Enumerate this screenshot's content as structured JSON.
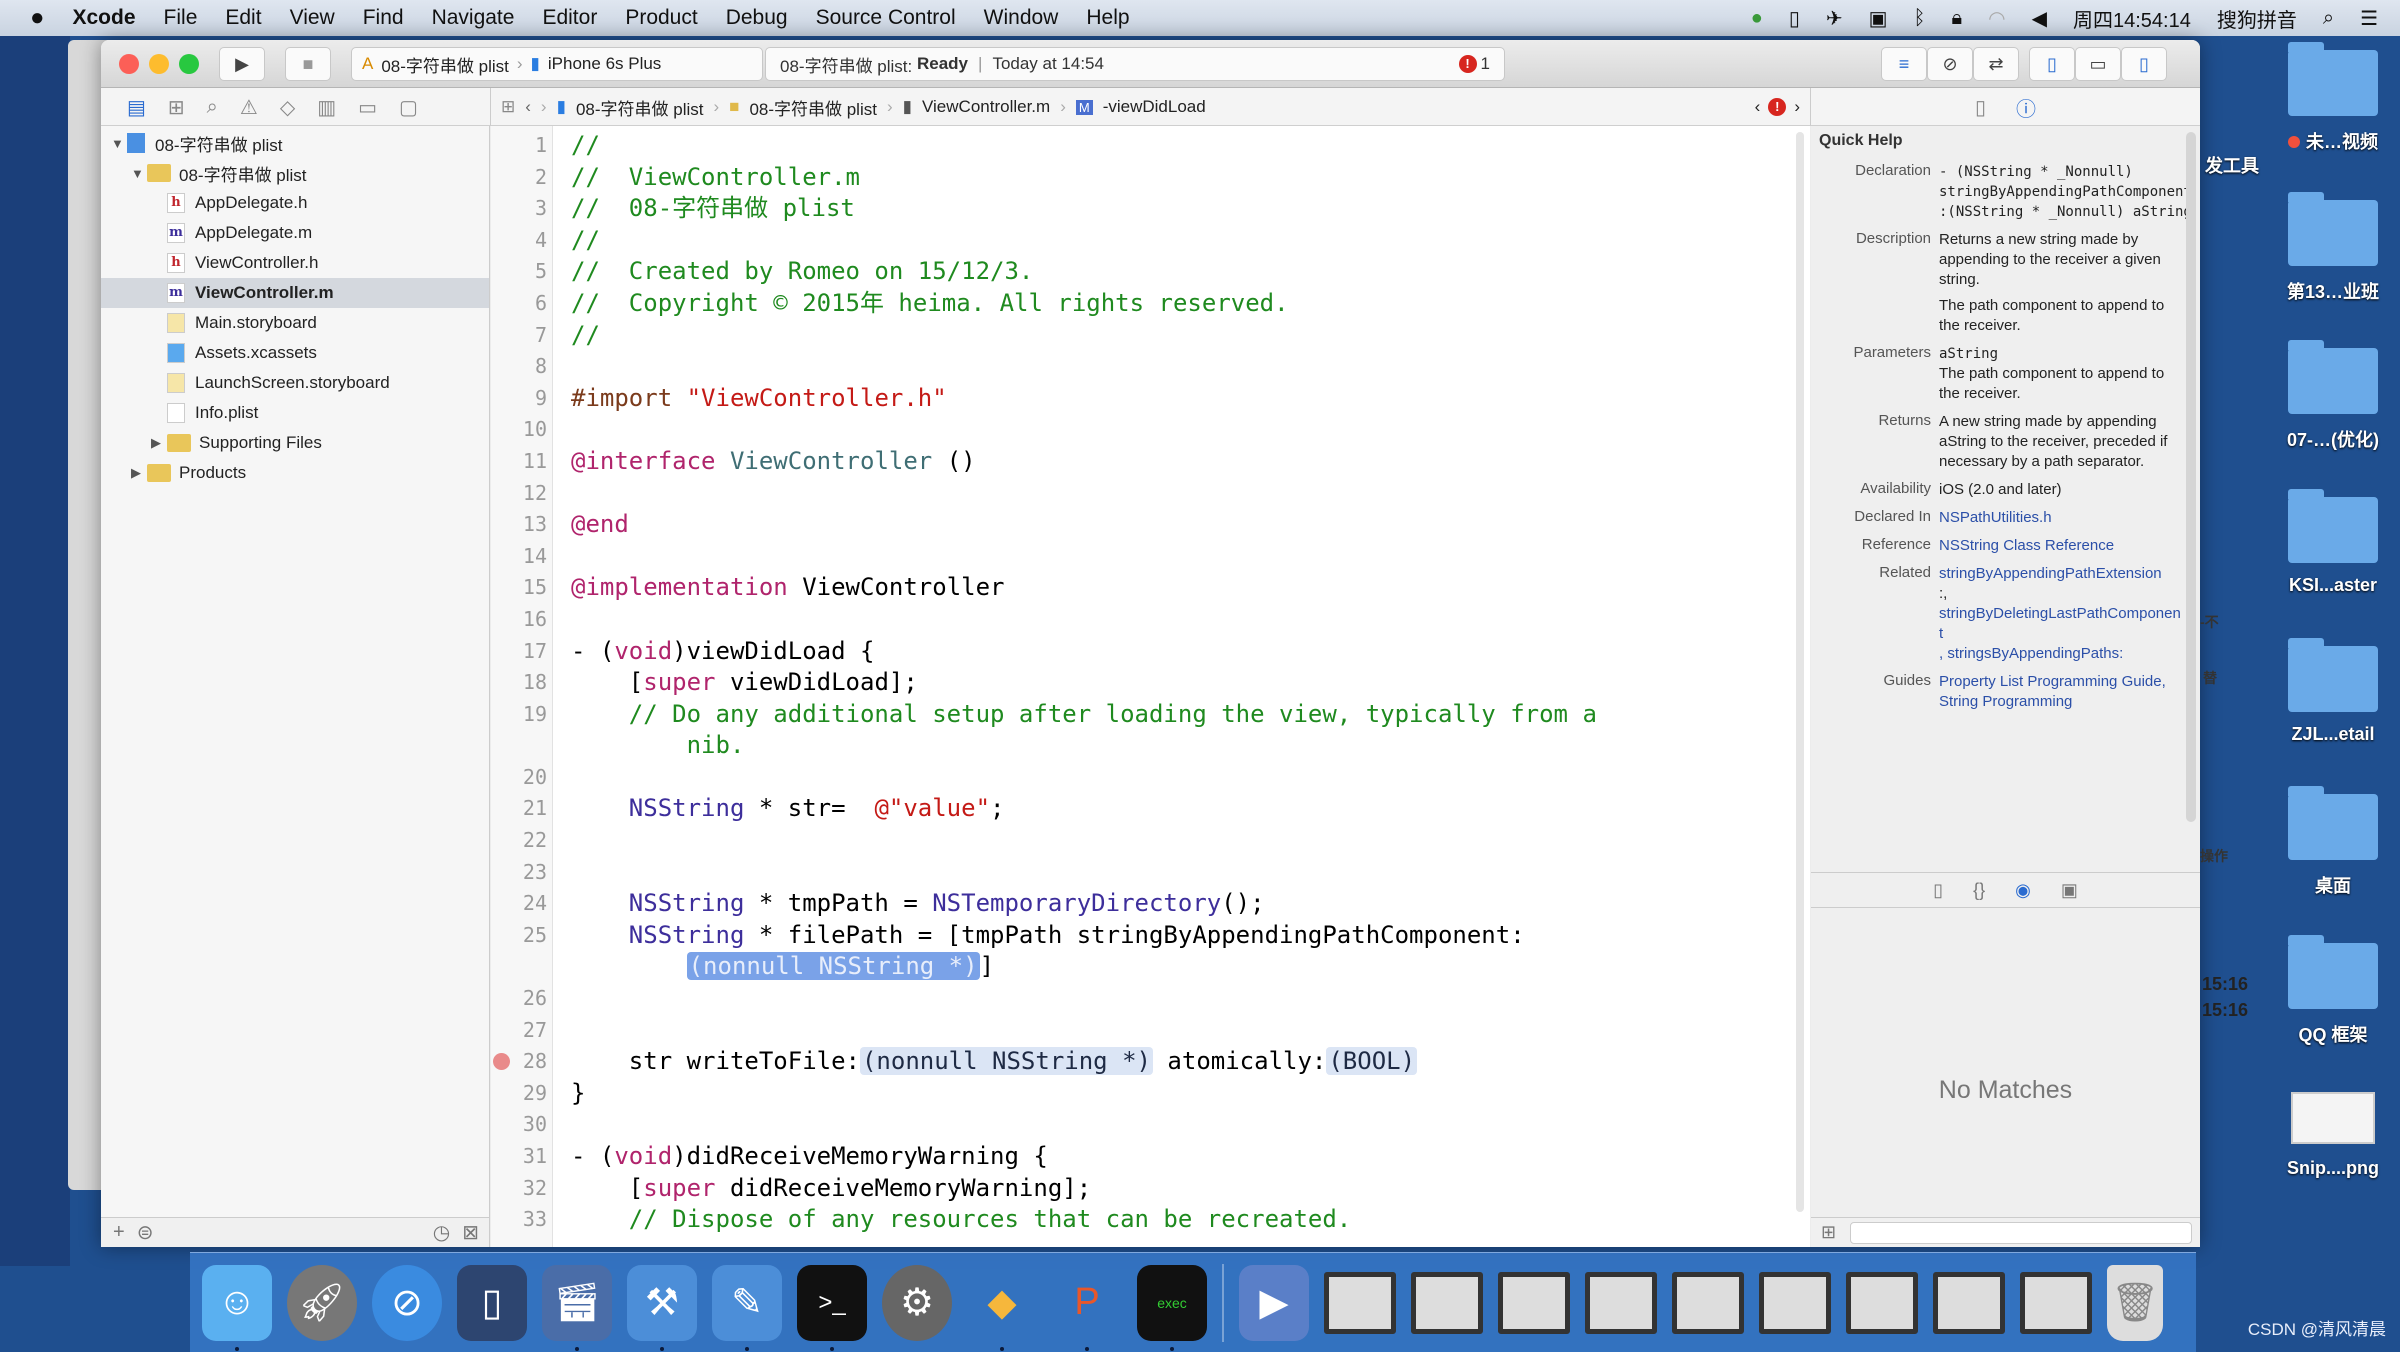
{
  "menubar": {
    "apple": "",
    "items": [
      "Xcode",
      "File",
      "Edit",
      "View",
      "Find",
      "Navigate",
      "Editor",
      "Product",
      "Debug",
      "Source Control",
      "Window",
      "Help"
    ],
    "clock": "周四14:54:14",
    "input_method": "搜狗拼音"
  },
  "toolbar": {
    "scheme": "08-字符串做 plist",
    "device": "iPhone 6s Plus",
    "status_project": "08-字符串做 plist:",
    "status_state": "Ready",
    "status_time": "Today at 14:54",
    "error_count": "1"
  },
  "jumpbar": {
    "crumbs": [
      "08-字符串做 plist",
      "08-字符串做 plist",
      "ViewController.m",
      "-viewDidLoad"
    ],
    "error_count": "!"
  },
  "navigator": {
    "items": [
      {
        "label": "08-字符串做 plist",
        "type": "project",
        "indent": 0,
        "expanded": true
      },
      {
        "label": "08-字符串做 plist",
        "type": "folder",
        "indent": 1,
        "expanded": true
      },
      {
        "label": "AppDelegate.h",
        "type": "h",
        "indent": 2
      },
      {
        "label": "AppDelegate.m",
        "type": "m",
        "indent": 2
      },
      {
        "label": "ViewController.h",
        "type": "h",
        "indent": 2
      },
      {
        "label": "ViewController.m",
        "type": "m",
        "indent": 2,
        "selected": true
      },
      {
        "label": "Main.storyboard",
        "type": "storyboard",
        "indent": 2
      },
      {
        "label": "Assets.xcassets",
        "type": "assets",
        "indent": 2
      },
      {
        "label": "LaunchScreen.storyboard",
        "type": "storyboard",
        "indent": 2
      },
      {
        "label": "Info.plist",
        "type": "plist",
        "indent": 2
      },
      {
        "label": "Supporting Files",
        "type": "folder",
        "indent": 2,
        "expanded": false
      },
      {
        "label": "Products",
        "type": "folder",
        "indent": 1,
        "expanded": false
      }
    ]
  },
  "editor": {
    "lines": [
      {
        "n": "1",
        "s": [
          [
            "//",
            "comment"
          ]
        ]
      },
      {
        "n": "2",
        "s": [
          [
            "//  ViewController.m",
            "comment"
          ]
        ]
      },
      {
        "n": "3",
        "s": [
          [
            "//  08-字符串做 plist",
            "comment"
          ]
        ]
      },
      {
        "n": "4",
        "s": [
          [
            "//",
            "comment"
          ]
        ]
      },
      {
        "n": "5",
        "s": [
          [
            "//  Created by Romeo on 15/12/3.",
            "comment"
          ]
        ]
      },
      {
        "n": "6",
        "s": [
          [
            "//  Copyright © 2015年 heima. All rights reserved.",
            "comment"
          ]
        ]
      },
      {
        "n": "7",
        "s": [
          [
            "//",
            "comment"
          ]
        ]
      },
      {
        "n": "8",
        "s": []
      },
      {
        "n": "9",
        "s": [
          [
            "#import",
            "directive"
          ],
          [
            " \"ViewController.h\"",
            "string"
          ]
        ]
      },
      {
        "n": "10",
        "s": []
      },
      {
        "n": "11",
        "s": [
          [
            "@interface",
            "keyword"
          ],
          [
            " ViewController",
            "class"
          ],
          [
            " ()",
            "plain"
          ]
        ]
      },
      {
        "n": "12",
        "s": []
      },
      {
        "n": "13",
        "s": [
          [
            "@end",
            "keyword"
          ]
        ]
      },
      {
        "n": "14",
        "s": []
      },
      {
        "n": "15",
        "s": [
          [
            "@implementation",
            "keyword"
          ],
          [
            " ViewController",
            "plain"
          ]
        ]
      },
      {
        "n": "16",
        "s": []
      },
      {
        "n": "17",
        "s": [
          [
            "- (",
            "plain"
          ],
          [
            "void",
            "keyword"
          ],
          [
            ")viewDidLoad {",
            "plain"
          ]
        ]
      },
      {
        "n": "18",
        "s": [
          [
            "    [",
            "plain"
          ],
          [
            "super",
            "keyword"
          ],
          [
            " viewDidLoad];",
            "plain"
          ]
        ]
      },
      {
        "n": "19",
        "s": [
          [
            "    // Do any additional setup after loading the view, typically from a",
            "comment"
          ]
        ]
      },
      {
        "n": "",
        "s": [
          [
            "        nib.",
            "comment"
          ]
        ]
      },
      {
        "n": "20",
        "s": []
      },
      {
        "n": "21",
        "s": [
          [
            "    ",
            "plain"
          ],
          [
            "NSString",
            "type"
          ],
          [
            " * str=  ",
            "plain"
          ],
          [
            "@\"value\"",
            "string"
          ],
          [
            ";",
            "plain"
          ]
        ]
      },
      {
        "n": "22",
        "s": []
      },
      {
        "n": "23",
        "s": []
      },
      {
        "n": "24",
        "s": [
          [
            "    ",
            "plain"
          ],
          [
            "NSString",
            "type"
          ],
          [
            " * tmpPath = ",
            "plain"
          ],
          [
            "NSTemporaryDirectory",
            "type"
          ],
          [
            "();",
            "plain"
          ]
        ]
      },
      {
        "n": "25",
        "s": [
          [
            "    ",
            "plain"
          ],
          [
            "NSString",
            "type"
          ],
          [
            " * filePath = [tmpPath stringByAppendingPathComponent:",
            "plain"
          ]
        ]
      },
      {
        "n": "",
        "s": [
          [
            "        ",
            "plain"
          ],
          [
            "(nonnull NSString *)",
            "placeholder-sel"
          ],
          [
            "]",
            "plain"
          ]
        ]
      },
      {
        "n": "26",
        "s": []
      },
      {
        "n": "27",
        "s": []
      },
      {
        "n": "28",
        "error": true,
        "s": [
          [
            "    str writeToFile:",
            "plain"
          ],
          [
            "(nonnull NSString *)",
            "placeholder"
          ],
          [
            " atomically:",
            "plain"
          ],
          [
            "(BOOL)",
            "placeholder"
          ]
        ]
      },
      {
        "n": "29",
        "s": [
          [
            "}",
            "plain"
          ]
        ]
      },
      {
        "n": "30",
        "s": []
      },
      {
        "n": "31",
        "s": [
          [
            "- (",
            "plain"
          ],
          [
            "void",
            "keyword"
          ],
          [
            ")didReceiveMemoryWarning {",
            "plain"
          ]
        ]
      },
      {
        "n": "32",
        "s": [
          [
            "    [",
            "plain"
          ],
          [
            "super",
            "keyword"
          ],
          [
            " didReceiveMemoryWarning];",
            "plain"
          ]
        ]
      },
      {
        "n": "33",
        "s": [
          [
            "    // Dispose of any resources that can be recreated.",
            "comment"
          ]
        ]
      }
    ]
  },
  "quick_help": {
    "title": "Quick Help",
    "declaration_label": "Declaration",
    "declaration": "- (NSString * _Nonnull) stringByAppendingPathComponent :(NSString * _Nonnull) aString",
    "description_label": "Description",
    "description": "Returns a new string made by appending to the receiver a given string.",
    "description2": "The path component to append to the receiver.",
    "parameters_label": "Parameters",
    "parameter_name": "aString",
    "parameter_desc": "The path component to append to the receiver.",
    "returns_label": "Returns",
    "returns": "A new string made by appending aString to the receiver, preceded if necessary by a path separator.",
    "availability_label": "Availability",
    "availability": "iOS (2.0 and later)",
    "declared_in_label": "Declared In",
    "declared_in": "NSPathUtilities.h",
    "reference_label": "Reference",
    "reference": "NSString Class Reference",
    "related_label": "Related",
    "related": [
      "stringByAppendingPathExtension",
      ":,",
      "stringByDeletingLastPathComponent",
      ", stringsByAppendingPaths:"
    ],
    "guides_label": "Guides",
    "guides": "Property List Programming Guide, String Programming"
  },
  "library": {
    "no_matches": "No Matches"
  },
  "desktop": {
    "icons": [
      "未…视频",
      "第13…业班",
      "07-…(优化)",
      "KSI...aster",
      "ZJL...etail",
      "桌面",
      "QQ 框架",
      "Snip....png"
    ],
    "partial_labels": [
      "发工具",
      "-不",
      "替",
      "操作",
      "15:16",
      "15:16"
    ]
  },
  "watermark": "CSDN @清风清晨",
  "colors": {
    "desktop": "#1f4f8f",
    "comment": "#1f8a1f",
    "keyword": "#b0246c",
    "string": "#c41a16",
    "type": "#3d2e9b",
    "selection": "#7aa2e8",
    "error": "#d7261f"
  }
}
